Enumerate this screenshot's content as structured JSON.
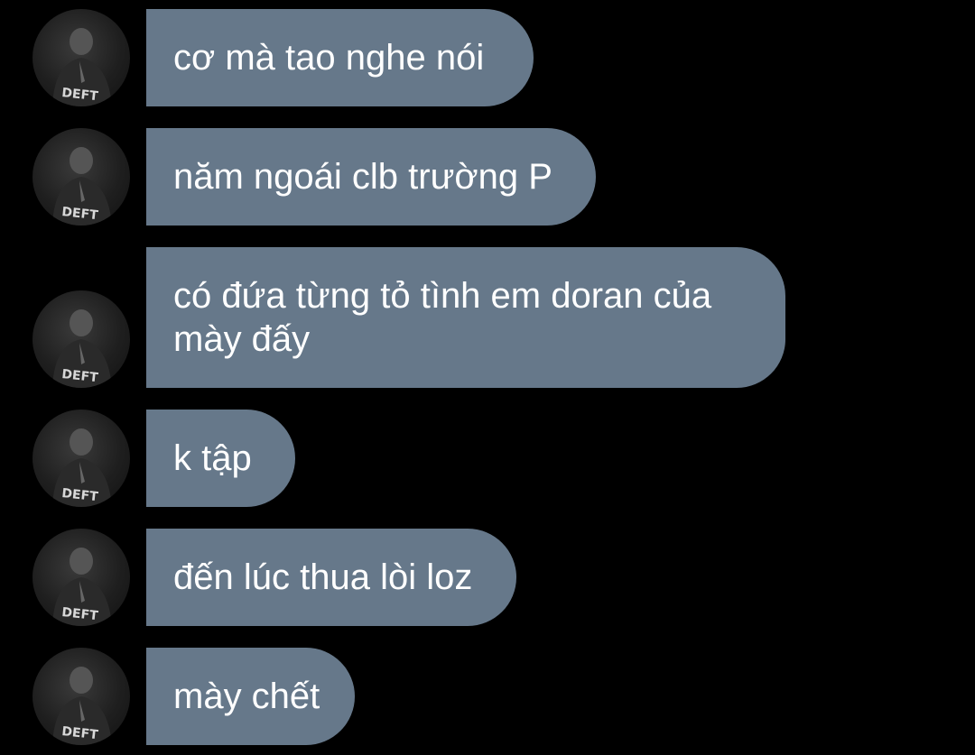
{
  "sender": {
    "avatar_icon": "avatar-icon",
    "avatar_text": "DEFT"
  },
  "colors": {
    "background": "#000000",
    "bubble": "#66788a",
    "text": "#ffffff"
  },
  "messages": [
    {
      "text": "cơ mà tao nghe nói"
    },
    {
      "text": "năm ngoái clb trường P"
    },
    {
      "text": "có đứa từng tỏ tình em doran của mày đấy"
    },
    {
      "text": "k tập"
    },
    {
      "text": "đến lúc thua lòi loz"
    },
    {
      "text": "mày chết"
    }
  ]
}
